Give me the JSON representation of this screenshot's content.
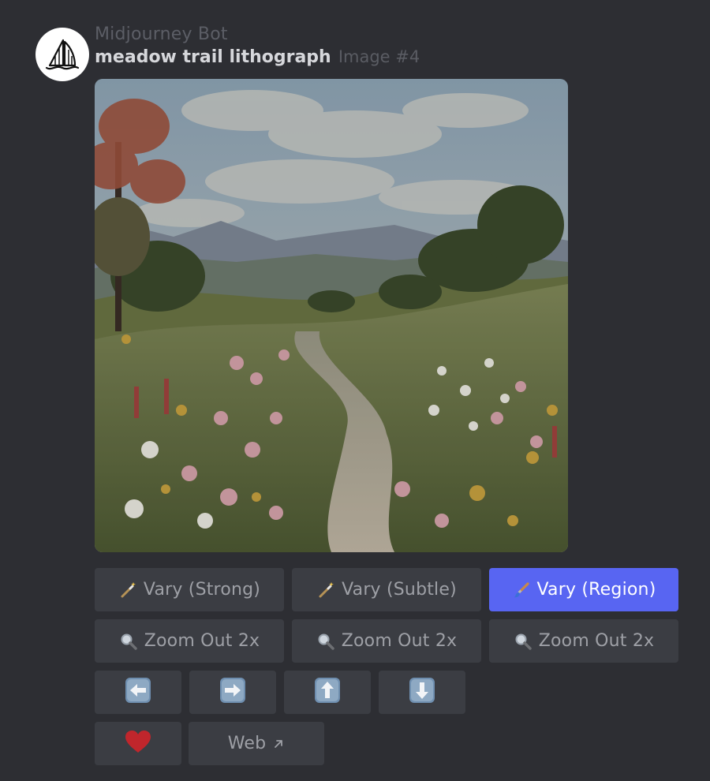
{
  "message": {
    "author": "Midjourney Bot",
    "prompt": "meadow trail lithograph",
    "image_label": "Image #4",
    "avatar_icon": "sailboat-logo-icon",
    "image_alt": "illustration of a dirt trail winding through a wildflower meadow toward distant hills"
  },
  "buttons": {
    "vary_strong": "Vary (Strong)",
    "vary_subtle": "Vary (Subtle)",
    "vary_region": "Vary (Region)",
    "zoom_out_1": "Zoom Out 2x",
    "zoom_out_2": "Zoom Out 2x",
    "zoom_out_3": "Zoom Out 2x",
    "web": "Web"
  },
  "icons": {
    "vary_strong": "magic-wand-icon",
    "vary_subtle": "magic-wand-icon",
    "vary_region": "paintbrush-icon",
    "zoom": "magnifier-icon",
    "pan": [
      "arrow-left-icon",
      "arrow-right-icon",
      "arrow-up-icon",
      "arrow-down-icon"
    ],
    "favorite": "heart-icon",
    "external": "external-link-icon"
  },
  "colors": {
    "background": "#2d2e33",
    "button": "#3b3d43",
    "primary_button": "#5865f2",
    "heart": "#c0262c"
  }
}
